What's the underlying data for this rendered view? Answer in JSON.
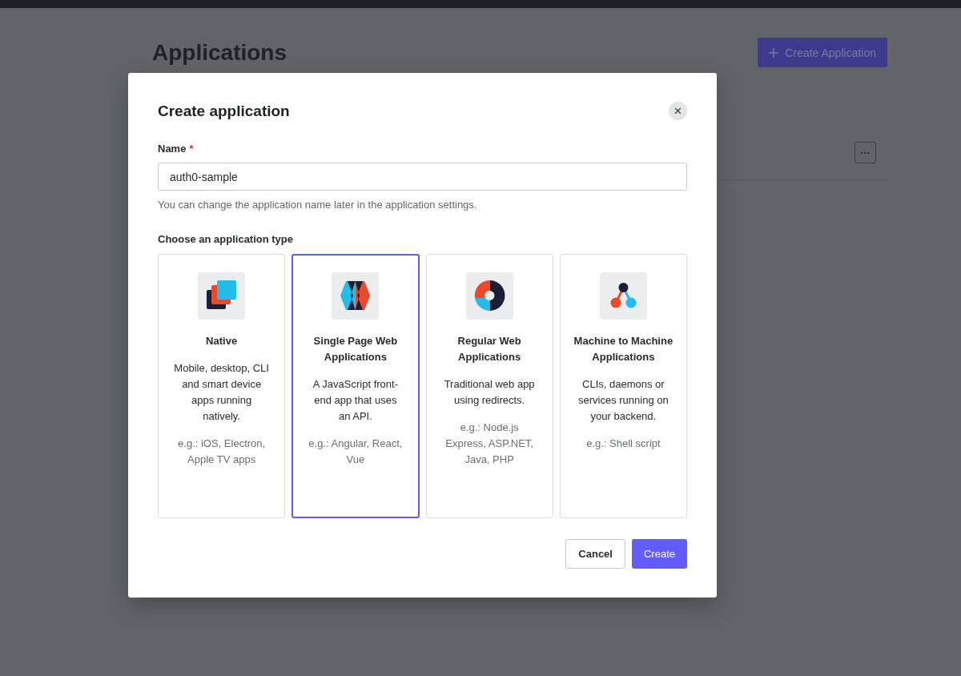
{
  "page": {
    "title": "Applications",
    "create_button": "Create Application",
    "more_button": "···"
  },
  "dialog": {
    "title": "Create application",
    "close": "×",
    "name_field": {
      "label": "Name",
      "required_mark": "*",
      "value": "auth0-sample",
      "hint": "You can change the application name later in the application settings."
    },
    "type_label": "Choose an application type",
    "types": [
      {
        "kind": "native",
        "title": "Native",
        "description": "Mobile, desktop, CLI and smart device apps running natively.",
        "examples": "e.g.: iOS, Electron, Apple TV apps",
        "selected": false
      },
      {
        "kind": "spa",
        "title": "Single Page Web Applications",
        "description": "A JavaScript front-end app that uses an API.",
        "examples": "e.g.: Angular, React, Vue",
        "selected": true
      },
      {
        "kind": "regular",
        "title": "Regular Web Applications",
        "description": "Traditional web app using redirects.",
        "examples": "e.g.: Node.js Express, ASP.NET, Java, PHP",
        "selected": false
      },
      {
        "kind": "m2m",
        "title": "Machine to Machine Applications",
        "description": "CLIs, daemons or services running on your backend.",
        "examples": "e.g.: Shell script",
        "selected": false
      }
    ],
    "buttons": {
      "cancel": "Cancel",
      "create": "Create"
    }
  }
}
